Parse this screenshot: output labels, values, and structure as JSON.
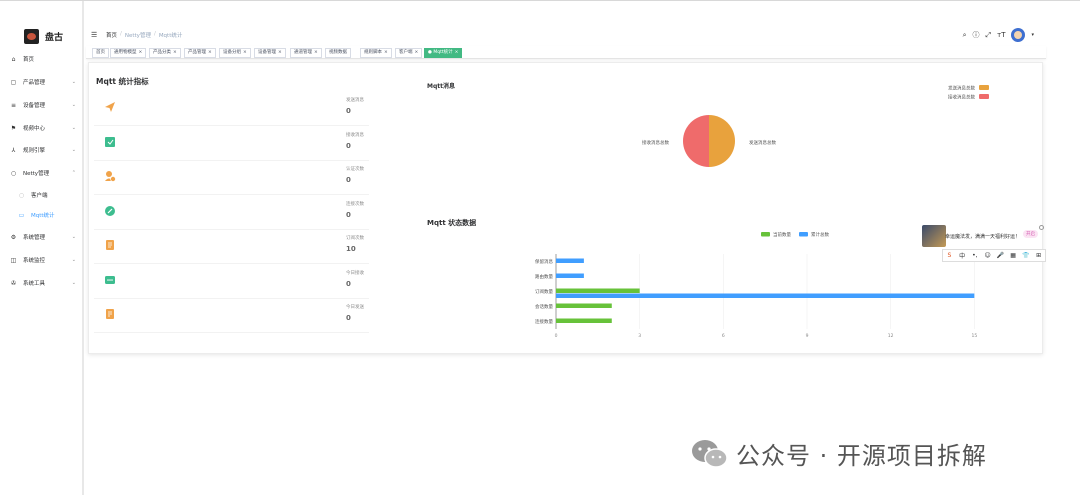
{
  "app": {
    "title": "盘古"
  },
  "sidebar": {
    "items": [
      {
        "label": "首页",
        "icon": "home-icon",
        "glyph": "⌂",
        "top": 50
      },
      {
        "label": "产品管理",
        "icon": "box-icon",
        "glyph": "▢",
        "top": 73,
        "arrow": "⌄"
      },
      {
        "label": "设备管理",
        "icon": "device-icon",
        "glyph": "≡",
        "top": 96,
        "arrow": "⌄"
      },
      {
        "label": "视频中心",
        "icon": "flag-icon",
        "glyph": "⚑",
        "top": 119,
        "arrow": "⌄"
      },
      {
        "label": "规则引擎",
        "icon": "rule-icon",
        "glyph": "⅄",
        "top": 141,
        "arrow": "⌄"
      },
      {
        "label": "Netty管理",
        "icon": "netty-icon",
        "glyph": "○",
        "top": 164,
        "arrow": "⌃"
      },
      {
        "label": "客户端",
        "icon": "circle-icon",
        "glyph": "○",
        "top": 186,
        "sub": true
      },
      {
        "label": "Mqtt统计",
        "icon": "stats-icon",
        "glyph": "▭",
        "top": 206,
        "sub": true,
        "active": true
      },
      {
        "label": "系统管理",
        "icon": "gear-icon",
        "glyph": "⚙",
        "top": 228,
        "arrow": "⌄"
      },
      {
        "label": "系统监控",
        "icon": "monitor-icon",
        "glyph": "◫",
        "top": 251,
        "arrow": "⌄"
      },
      {
        "label": "系统工具",
        "icon": "tools-icon",
        "glyph": "✇",
        "top": 274,
        "arrow": "⌄"
      }
    ]
  },
  "header": {
    "breadcrumbs": [
      "首页",
      "Netty管理",
      "Mqtt统计"
    ],
    "tools": [
      "search-icon",
      "help-icon",
      "fullscreen-icon",
      "font-size-icon"
    ]
  },
  "tags": [
    {
      "label": "首页",
      "left": 6,
      "closable": false
    },
    {
      "label": "通用物模型",
      "left": 24,
      "closable": true
    },
    {
      "label": "产品分类",
      "left": 63,
      "closable": true
    },
    {
      "label": "产品管理",
      "left": 98,
      "closable": true
    },
    {
      "label": "设备分组",
      "left": 133,
      "closable": true
    },
    {
      "label": "设备管理",
      "left": 168,
      "closable": true
    },
    {
      "label": "通道管理",
      "left": 204,
      "closable": true
    },
    {
      "label": "视频数据",
      "left": 239,
      "closable": false
    },
    {
      "label": "规则脚本",
      "left": 274,
      "closable": true
    },
    {
      "label": "客户端",
      "left": 309,
      "closable": true
    },
    {
      "label": "Mqtt统计",
      "left": 338,
      "closable": true,
      "active": true
    }
  ],
  "stats": {
    "title": "Mqtt 统计指标",
    "items": [
      {
        "label": "发送消息",
        "value": "0",
        "icon": "send-icon",
        "color": "#f0a34a"
      },
      {
        "label": "接收消息",
        "value": "0",
        "icon": "receive-icon",
        "color": "#3dbd8f"
      },
      {
        "label": "认证次数",
        "value": "0",
        "icon": "auth-icon",
        "color": "#f0a34a"
      },
      {
        "label": "连接次数",
        "value": "0",
        "icon": "link-icon",
        "color": "#3dbd8f"
      },
      {
        "label": "订阅次数",
        "value": "10",
        "icon": "subscribe-icon",
        "color": "#f0a34a"
      },
      {
        "label": "今日接收",
        "value": "0",
        "icon": "message-icon",
        "color": "#3dbd8f"
      },
      {
        "label": "今日发送",
        "value": "0",
        "icon": "doc-icon",
        "color": "#f0a34a"
      }
    ]
  },
  "chart_data": [
    {
      "type": "pie",
      "title": "Mqtt消息",
      "legend": [
        {
          "name": "发送消息总数",
          "color": "#e8a23d"
        },
        {
          "name": "接收消息总数",
          "color": "#ef6b6b"
        }
      ],
      "slices": [
        {
          "name": "发送消息总数",
          "value": 1,
          "color": "#e8a23d"
        },
        {
          "name": "接收消息总数",
          "value": 1,
          "color": "#ef6b6b"
        }
      ],
      "legend_position": "top-right"
    },
    {
      "type": "bar",
      "orientation": "horizontal",
      "title": "Mqtt 状态数据",
      "categories": [
        "保留消息",
        "路由数量",
        "订阅数量",
        "会话数量",
        "连接数量"
      ],
      "series": [
        {
          "name": "当前数量",
          "color": "#67c23a",
          "values": [
            0,
            0,
            3,
            2,
            2
          ]
        },
        {
          "name": "累计总数",
          "color": "#409eff",
          "values": [
            1,
            1,
            15,
            0,
            0
          ]
        }
      ],
      "xlim": [
        0,
        18
      ],
      "xticks": [
        0,
        3,
        6,
        9,
        12,
        15,
        18
      ],
      "legend_position": "top-center",
      "grid": true
    }
  ],
  "widget": {
    "text": "幸运魔法发，满满一天福利好运！",
    "badge": "开启",
    "toolbar": [
      "S",
      "中",
      "•,",
      "☺",
      "🎤",
      "▦",
      "👕",
      "⊞"
    ]
  },
  "watermark": {
    "text": "公众号 · 开源项目拆解"
  }
}
